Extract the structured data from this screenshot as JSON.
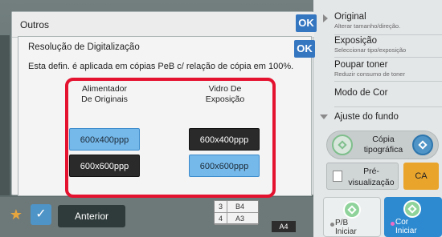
{
  "outer_dialog": {
    "title": "Outros",
    "ok_label": "OK"
  },
  "dialog": {
    "title": "Resolução de Digitalização",
    "ok_label": "OK",
    "info": "Esta defin. é aplicada em cópias PeB c/ relação de cópia em 100%.",
    "columns": [
      {
        "heading": "Alimentador\nDe Originais",
        "options": [
          "600x400ppp",
          "600x600ppp"
        ],
        "selected": "600x400ppp"
      },
      {
        "heading": "Vidro De\nExposição",
        "options": [
          "600x400ppp",
          "600x600ppp"
        ],
        "selected": "600x600ppp"
      }
    ]
  },
  "right_panel": {
    "items": [
      {
        "title": "Original",
        "subtitle": "Alterar tamanho/direção."
      },
      {
        "title": "Exposição",
        "subtitle": "Seleccionar tipo/exposição"
      },
      {
        "title": "Poupar toner",
        "subtitle": "Reduzir consumo de toner"
      },
      {
        "title": "Modo de Cor",
        "subtitle": ""
      },
      {
        "title": "Ajuste do fundo",
        "subtitle": ""
      }
    ],
    "duplex_label": "Cópia\ntipográfica",
    "preview_label": "Pré-\nvisualização",
    "ca_label": "CA",
    "start_bw_label": "P/B\nIniciar",
    "start_color_label": "Cor\nIniciar"
  },
  "bottom_bar": {
    "prev_label": "Anterior",
    "paper_rows": [
      {
        "num": "3",
        "size": "B4"
      },
      {
        "num": "4",
        "size": "A3"
      }
    ],
    "paper_selected": "A4"
  },
  "colors": {
    "ok_blue": "#3576c1",
    "highlight_red": "#e4122f",
    "selected_blue": "#75b8ea",
    "unselected_dark": "#2a2a2a",
    "ca_orange": "#e9a42c",
    "start_color_blue": "#2e8ad0"
  }
}
